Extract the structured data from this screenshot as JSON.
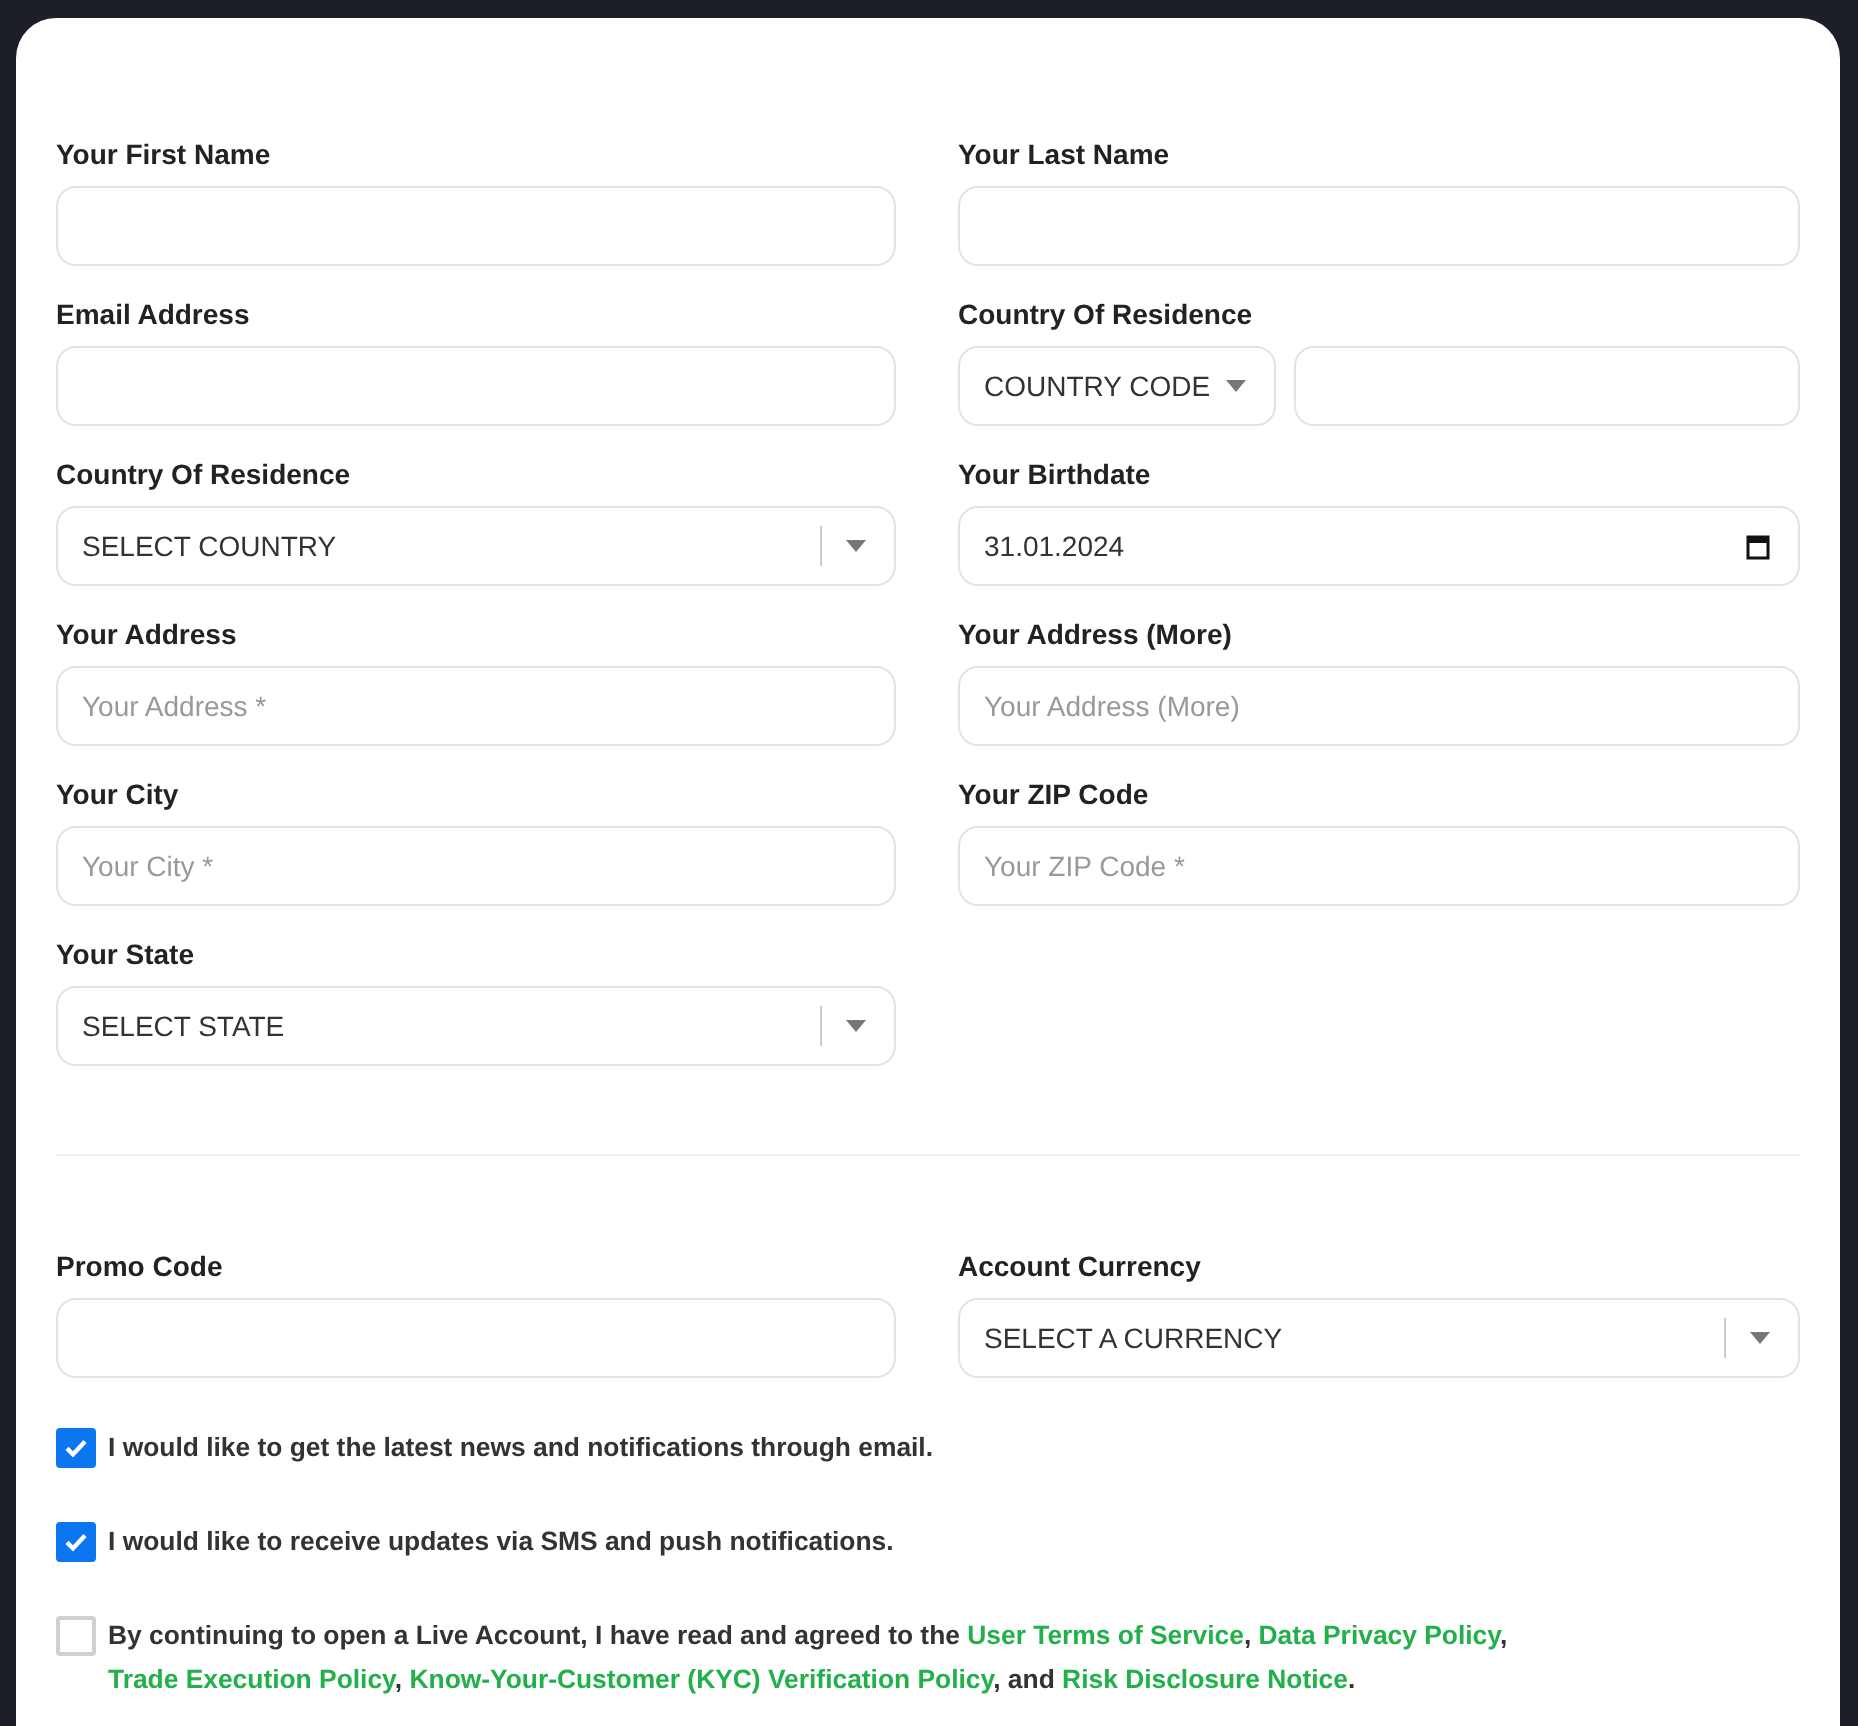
{
  "sections": [
    {
      "fields": [
        {
          "label": "Your First Name",
          "kind": "text"
        },
        {
          "label": "Your Last Name",
          "kind": "text"
        },
        {
          "label": "Email Address",
          "kind": "text"
        },
        {
          "label": "Country Of Residence",
          "kind": "phone",
          "code": "COUNTRY CODE"
        },
        {
          "label": "Country Of Residence",
          "kind": "select",
          "value": "SELECT COUNTRY"
        },
        {
          "label": "Your Birthdate",
          "kind": "date",
          "value": "31.01.2024"
        },
        {
          "label": "Your Address",
          "kind": "text",
          "placeholder": "Your Address *"
        },
        {
          "label": "Your Address (More)",
          "kind": "text",
          "placeholder": "Your Address (More)"
        },
        {
          "label": "Your City",
          "kind": "text",
          "placeholder": "Your City *"
        },
        {
          "label": "Your ZIP Code",
          "kind": "text",
          "placeholder": "Your ZIP Code *"
        },
        {
          "label": "Your State",
          "kind": "select",
          "value": "SELECT STATE"
        }
      ]
    },
    {
      "fields": [
        {
          "label": "Promo Code",
          "kind": "text"
        },
        {
          "label": "Account Currency",
          "kind": "select",
          "value": "SELECT A CURRENCY"
        }
      ]
    }
  ],
  "checkboxes": [
    {
      "checked": true,
      "parts": [
        {
          "kind": "text",
          "text": "I would like to get the latest news and notifications through email."
        }
      ]
    },
    {
      "checked": true,
      "parts": [
        {
          "kind": "text",
          "text": "I would like to receive updates via SMS and push notifications."
        }
      ]
    },
    {
      "checked": false,
      "parts": [
        {
          "kind": "text",
          "text": "By continuing to open a Live Account, I have read and agreed to the "
        },
        {
          "kind": "link",
          "text": "User Terms of Service"
        },
        {
          "kind": "text",
          "text": ", "
        },
        {
          "kind": "link",
          "text": "Data Privacy Policy"
        },
        {
          "kind": "text",
          "text": ", "
        },
        {
          "kind": "link",
          "text": "Trade Execution Policy"
        },
        {
          "kind": "text",
          "text": ", "
        },
        {
          "kind": "link",
          "text": "Know-Your-Customer (KYC) Verification Policy"
        },
        {
          "kind": "text",
          "text": ", and "
        },
        {
          "kind": "link",
          "text": "Risk Disclosure Notice"
        },
        {
          "kind": "text",
          "text": "."
        }
      ]
    }
  ]
}
